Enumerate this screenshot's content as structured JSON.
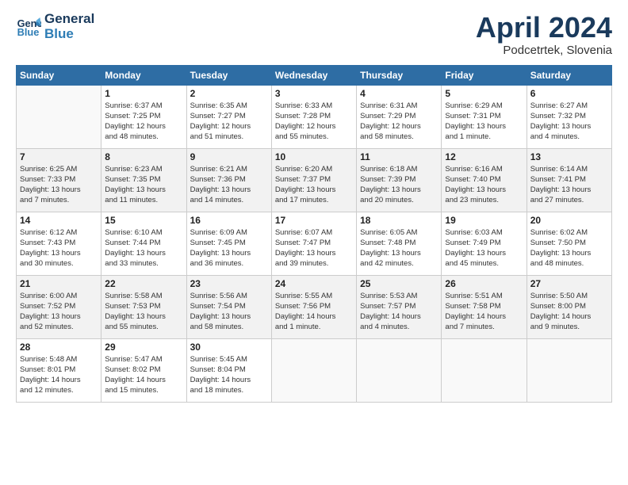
{
  "header": {
    "logo_line1": "General",
    "logo_line2": "Blue",
    "month": "April 2024",
    "location": "Podcetrtek, Slovenia"
  },
  "weekdays": [
    "Sunday",
    "Monday",
    "Tuesday",
    "Wednesday",
    "Thursday",
    "Friday",
    "Saturday"
  ],
  "weeks": [
    [
      {
        "day": "",
        "info": ""
      },
      {
        "day": "1",
        "info": "Sunrise: 6:37 AM\nSunset: 7:25 PM\nDaylight: 12 hours\nand 48 minutes."
      },
      {
        "day": "2",
        "info": "Sunrise: 6:35 AM\nSunset: 7:27 PM\nDaylight: 12 hours\nand 51 minutes."
      },
      {
        "day": "3",
        "info": "Sunrise: 6:33 AM\nSunset: 7:28 PM\nDaylight: 12 hours\nand 55 minutes."
      },
      {
        "day": "4",
        "info": "Sunrise: 6:31 AM\nSunset: 7:29 PM\nDaylight: 12 hours\nand 58 minutes."
      },
      {
        "day": "5",
        "info": "Sunrise: 6:29 AM\nSunset: 7:31 PM\nDaylight: 13 hours\nand 1 minute."
      },
      {
        "day": "6",
        "info": "Sunrise: 6:27 AM\nSunset: 7:32 PM\nDaylight: 13 hours\nand 4 minutes."
      }
    ],
    [
      {
        "day": "7",
        "info": "Sunrise: 6:25 AM\nSunset: 7:33 PM\nDaylight: 13 hours\nand 7 minutes."
      },
      {
        "day": "8",
        "info": "Sunrise: 6:23 AM\nSunset: 7:35 PM\nDaylight: 13 hours\nand 11 minutes."
      },
      {
        "day": "9",
        "info": "Sunrise: 6:21 AM\nSunset: 7:36 PM\nDaylight: 13 hours\nand 14 minutes."
      },
      {
        "day": "10",
        "info": "Sunrise: 6:20 AM\nSunset: 7:37 PM\nDaylight: 13 hours\nand 17 minutes."
      },
      {
        "day": "11",
        "info": "Sunrise: 6:18 AM\nSunset: 7:39 PM\nDaylight: 13 hours\nand 20 minutes."
      },
      {
        "day": "12",
        "info": "Sunrise: 6:16 AM\nSunset: 7:40 PM\nDaylight: 13 hours\nand 23 minutes."
      },
      {
        "day": "13",
        "info": "Sunrise: 6:14 AM\nSunset: 7:41 PM\nDaylight: 13 hours\nand 27 minutes."
      }
    ],
    [
      {
        "day": "14",
        "info": "Sunrise: 6:12 AM\nSunset: 7:43 PM\nDaylight: 13 hours\nand 30 minutes."
      },
      {
        "day": "15",
        "info": "Sunrise: 6:10 AM\nSunset: 7:44 PM\nDaylight: 13 hours\nand 33 minutes."
      },
      {
        "day": "16",
        "info": "Sunrise: 6:09 AM\nSunset: 7:45 PM\nDaylight: 13 hours\nand 36 minutes."
      },
      {
        "day": "17",
        "info": "Sunrise: 6:07 AM\nSunset: 7:47 PM\nDaylight: 13 hours\nand 39 minutes."
      },
      {
        "day": "18",
        "info": "Sunrise: 6:05 AM\nSunset: 7:48 PM\nDaylight: 13 hours\nand 42 minutes."
      },
      {
        "day": "19",
        "info": "Sunrise: 6:03 AM\nSunset: 7:49 PM\nDaylight: 13 hours\nand 45 minutes."
      },
      {
        "day": "20",
        "info": "Sunrise: 6:02 AM\nSunset: 7:50 PM\nDaylight: 13 hours\nand 48 minutes."
      }
    ],
    [
      {
        "day": "21",
        "info": "Sunrise: 6:00 AM\nSunset: 7:52 PM\nDaylight: 13 hours\nand 52 minutes."
      },
      {
        "day": "22",
        "info": "Sunrise: 5:58 AM\nSunset: 7:53 PM\nDaylight: 13 hours\nand 55 minutes."
      },
      {
        "day": "23",
        "info": "Sunrise: 5:56 AM\nSunset: 7:54 PM\nDaylight: 13 hours\nand 58 minutes."
      },
      {
        "day": "24",
        "info": "Sunrise: 5:55 AM\nSunset: 7:56 PM\nDaylight: 14 hours\nand 1 minute."
      },
      {
        "day": "25",
        "info": "Sunrise: 5:53 AM\nSunset: 7:57 PM\nDaylight: 14 hours\nand 4 minutes."
      },
      {
        "day": "26",
        "info": "Sunrise: 5:51 AM\nSunset: 7:58 PM\nDaylight: 14 hours\nand 7 minutes."
      },
      {
        "day": "27",
        "info": "Sunrise: 5:50 AM\nSunset: 8:00 PM\nDaylight: 14 hours\nand 9 minutes."
      }
    ],
    [
      {
        "day": "28",
        "info": "Sunrise: 5:48 AM\nSunset: 8:01 PM\nDaylight: 14 hours\nand 12 minutes."
      },
      {
        "day": "29",
        "info": "Sunrise: 5:47 AM\nSunset: 8:02 PM\nDaylight: 14 hours\nand 15 minutes."
      },
      {
        "day": "30",
        "info": "Sunrise: 5:45 AM\nSunset: 8:04 PM\nDaylight: 14 hours\nand 18 minutes."
      },
      {
        "day": "",
        "info": ""
      },
      {
        "day": "",
        "info": ""
      },
      {
        "day": "",
        "info": ""
      },
      {
        "day": "",
        "info": ""
      }
    ]
  ]
}
